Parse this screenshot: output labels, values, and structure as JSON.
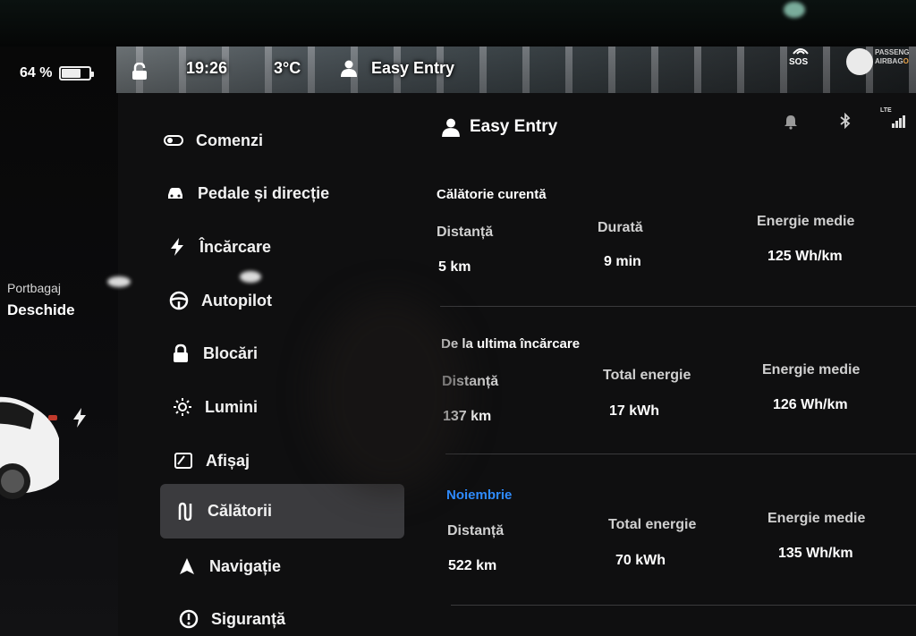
{
  "status_bar": {
    "battery_percent": "64 %",
    "battery_level": 0.64,
    "time": "19:26",
    "temperature": "3°C",
    "profile_name": "Easy Entry",
    "sos_label": "SOS",
    "airbag_line1": "PASSENG",
    "airbag_line2": "AIRBAG",
    "airbag_line2_suffix": "O"
  },
  "car_panel": {
    "trunk_label": "Portbagaj",
    "trunk_action": "Deschide"
  },
  "menu": [
    {
      "label": "Comenzi",
      "icon": "toggle-icon"
    },
    {
      "label": "Pedale și direcție",
      "icon": "car-icon"
    },
    {
      "label": "Încărcare",
      "icon": "bolt-icon"
    },
    {
      "label": "Autopilot",
      "icon": "steering-wheel-icon"
    },
    {
      "label": "Blocări",
      "icon": "lock-icon"
    },
    {
      "label": "Lumini",
      "icon": "sun-icon"
    },
    {
      "label": "Afișaj",
      "icon": "display-icon"
    },
    {
      "label": "Călătorii",
      "icon": "trips-icon",
      "active": true
    },
    {
      "label": "Navigație",
      "icon": "navigation-arrow-icon"
    },
    {
      "label": "Siguranță",
      "icon": "warning-circle-icon"
    }
  ],
  "header": {
    "profile_name": "Easy Entry",
    "network": "LTE"
  },
  "trips": {
    "current": {
      "title": "Călătorie curentă",
      "labels": [
        "Distanță",
        "Durată",
        "Energie medie"
      ],
      "values": [
        "5 km",
        "9 min",
        "125 Wh/km"
      ]
    },
    "since_charge": {
      "title": "De la ultima încărcare",
      "labels": [
        "Distanță",
        "Total energie",
        "Energie medie"
      ],
      "values": [
        "137 km",
        "17 kWh",
        "126 Wh/km"
      ]
    },
    "month": {
      "title": "Noiembrie",
      "labels": [
        "Distanță",
        "Total energie",
        "Energie medie"
      ],
      "values": [
        "522 km",
        "70 kWh",
        "135 Wh/km"
      ]
    }
  }
}
